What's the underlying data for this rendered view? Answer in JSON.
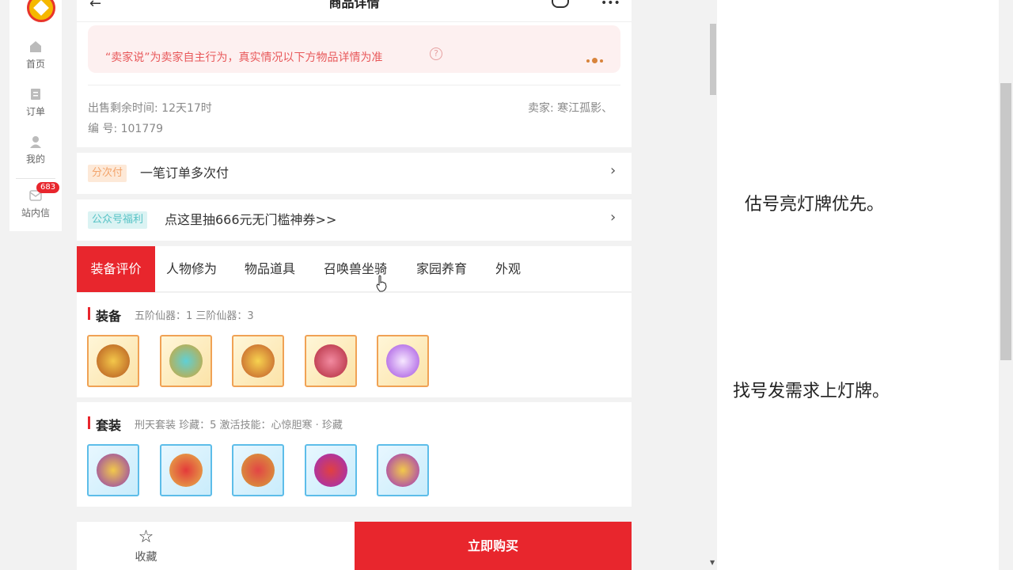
{
  "nav": {
    "items": [
      {
        "label": "首页",
        "icon": "home-icon"
      },
      {
        "label": "订单",
        "icon": "order-icon"
      },
      {
        "label": "我的",
        "icon": "user-icon"
      },
      {
        "label": "站内信",
        "icon": "message-icon",
        "badge": "683"
      }
    ]
  },
  "header": {
    "title": "商品详情"
  },
  "notice": {
    "text": "“卖家说”为卖家自主行为，真实情况以下方物品详情为准"
  },
  "meta": {
    "time_left": "出售剩余时间: 12天17时",
    "seller": "卖家: 寒江孤影、",
    "id_label": "编 号: 101779"
  },
  "installment": {
    "tag": "分次付",
    "text": "一笔订单多次付"
  },
  "promo": {
    "tag": "公众号福利",
    "text": "点这里抽666元无门槛神券>>"
  },
  "tabs": [
    "装备评价",
    "人物修为",
    "物品道具",
    "召唤兽坐骑",
    "家园养育",
    "外观"
  ],
  "equipment": {
    "title": "装备",
    "summary": "五阶仙器：1   三阶仙器：3"
  },
  "suit": {
    "title": "套装",
    "summary": "刑天套装   珍藏：5   激活技能：心惊胆寒 · 珍藏"
  },
  "bottom": {
    "favorite": "收藏",
    "buy": "立即购买"
  },
  "right_panel": {
    "line1": "估号亮灯牌优先。",
    "line2": "找号发需求上灯牌。"
  },
  "colors": {
    "accent": "#e8262d",
    "gold_frame": "#f0a255",
    "blue_frame": "#5dbde9"
  }
}
